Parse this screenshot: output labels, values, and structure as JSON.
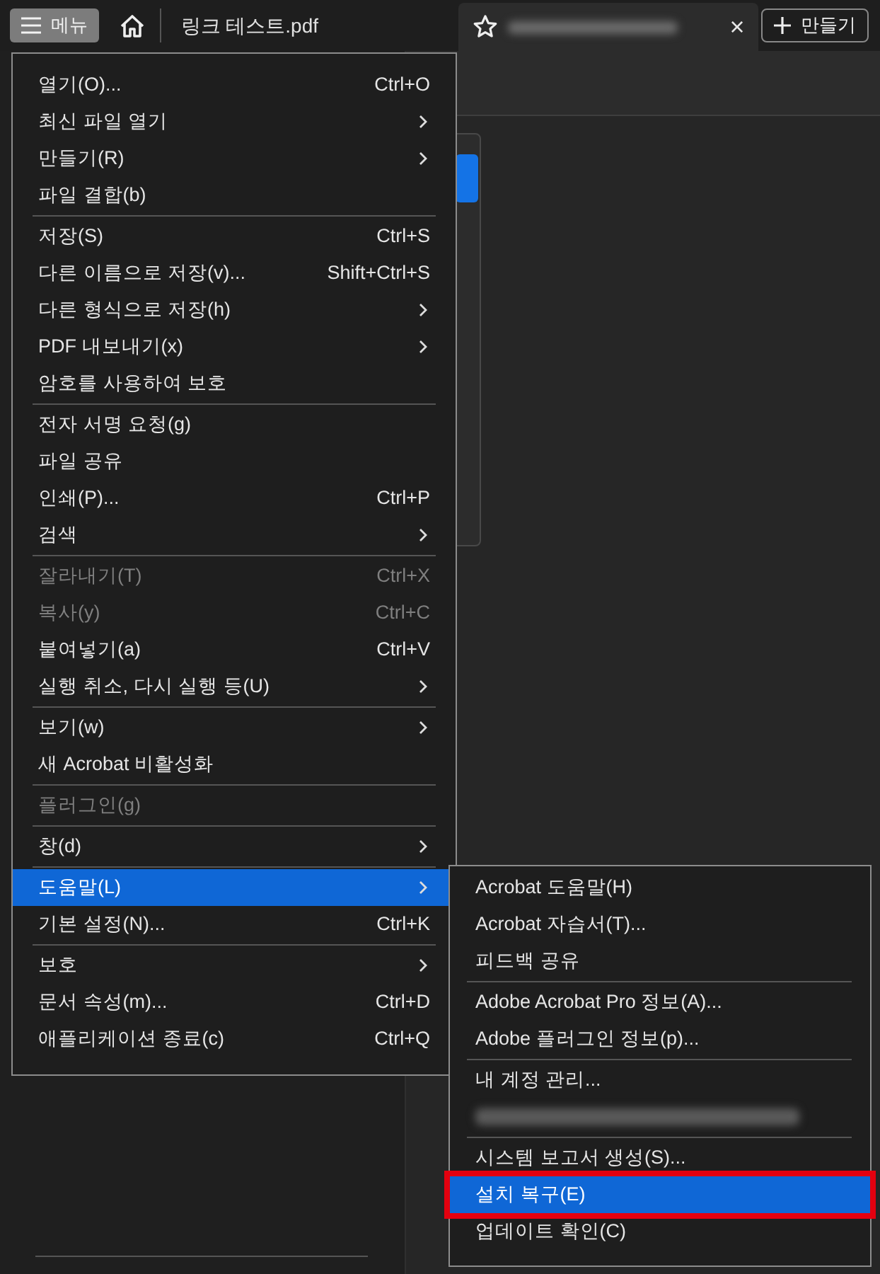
{
  "toolbar": {
    "menu_button": "메뉴",
    "document_tab": "링크 테스트.pdf",
    "second_tab": {
      "title_redacted": true,
      "close": "×"
    },
    "create_button": "만들기"
  },
  "menu": {
    "items": [
      {
        "kind": "item",
        "label": "열기(O)...",
        "shortcut": "Ctrl+O",
        "submenu": false,
        "disabled": false,
        "selected": false
      },
      {
        "kind": "item",
        "label": "최신 파일 열기",
        "submenu": true,
        "disabled": false,
        "selected": false
      },
      {
        "kind": "item",
        "label": "만들기(R)",
        "submenu": true,
        "disabled": false,
        "selected": false
      },
      {
        "kind": "item",
        "label": "파일 결합(b)",
        "submenu": false,
        "disabled": false,
        "selected": false
      },
      {
        "kind": "separator"
      },
      {
        "kind": "item",
        "label": "저장(S)",
        "shortcut": "Ctrl+S",
        "submenu": false,
        "disabled": false,
        "selected": false
      },
      {
        "kind": "item",
        "label": "다른 이름으로 저장(v)...",
        "shortcut": "Shift+Ctrl+S",
        "submenu": false,
        "disabled": false,
        "selected": false
      },
      {
        "kind": "item",
        "label": "다른 형식으로 저장(h)",
        "submenu": true,
        "disabled": false,
        "selected": false
      },
      {
        "kind": "item",
        "label": "PDF 내보내기(x)",
        "submenu": true,
        "disabled": false,
        "selected": false
      },
      {
        "kind": "item",
        "label": "암호를 사용하여 보호",
        "submenu": false,
        "disabled": false,
        "selected": false
      },
      {
        "kind": "separator"
      },
      {
        "kind": "item",
        "label": "전자 서명 요청(g)",
        "submenu": false,
        "disabled": false,
        "selected": false
      },
      {
        "kind": "item",
        "label": "파일 공유",
        "submenu": false,
        "disabled": false,
        "selected": false
      },
      {
        "kind": "item",
        "label": "인쇄(P)...",
        "shortcut": "Ctrl+P",
        "submenu": false,
        "disabled": false,
        "selected": false
      },
      {
        "kind": "item",
        "label": "검색",
        "submenu": true,
        "disabled": false,
        "selected": false
      },
      {
        "kind": "separator"
      },
      {
        "kind": "item",
        "label": "잘라내기(T)",
        "shortcut": "Ctrl+X",
        "submenu": false,
        "disabled": true,
        "selected": false
      },
      {
        "kind": "item",
        "label": "복사(y)",
        "shortcut": "Ctrl+C",
        "submenu": false,
        "disabled": true,
        "selected": false
      },
      {
        "kind": "item",
        "label": "붙여넣기(a)",
        "shortcut": "Ctrl+V",
        "submenu": false,
        "disabled": false,
        "selected": false
      },
      {
        "kind": "item",
        "label": "실행 취소, 다시 실행 등(U)",
        "submenu": true,
        "disabled": false,
        "selected": false
      },
      {
        "kind": "separator"
      },
      {
        "kind": "item",
        "label": "보기(w)",
        "submenu": true,
        "disabled": false,
        "selected": false
      },
      {
        "kind": "item",
        "label": "새 Acrobat 비활성화",
        "submenu": false,
        "disabled": false,
        "selected": false
      },
      {
        "kind": "separator"
      },
      {
        "kind": "item",
        "label": "플러그인(g)",
        "submenu": false,
        "disabled": true,
        "selected": false
      },
      {
        "kind": "separator"
      },
      {
        "kind": "item",
        "label": "창(d)",
        "submenu": true,
        "disabled": false,
        "selected": false
      },
      {
        "kind": "separator"
      },
      {
        "kind": "item",
        "label": "도움말(L)",
        "submenu": true,
        "disabled": false,
        "selected": true
      },
      {
        "kind": "item",
        "label": "기본 설정(N)...",
        "shortcut": "Ctrl+K",
        "submenu": false,
        "disabled": false,
        "selected": false
      },
      {
        "kind": "separator"
      },
      {
        "kind": "item",
        "label": "보호",
        "submenu": true,
        "disabled": false,
        "selected": false
      },
      {
        "kind": "item",
        "label": "문서 속성(m)...",
        "shortcut": "Ctrl+D",
        "submenu": false,
        "disabled": false,
        "selected": false
      },
      {
        "kind": "item",
        "label": "애플리케이션 종료(c)",
        "shortcut": "Ctrl+Q",
        "submenu": false,
        "disabled": false,
        "selected": false
      }
    ]
  },
  "submenu": {
    "items": [
      {
        "kind": "item",
        "label": "Acrobat 도움말(H)",
        "selected": false,
        "annotated": false
      },
      {
        "kind": "item",
        "label": "Acrobat 자습서(T)...",
        "selected": false,
        "annotated": false
      },
      {
        "kind": "item",
        "label": "피드백 공유",
        "selected": false,
        "annotated": false
      },
      {
        "kind": "separator"
      },
      {
        "kind": "item",
        "label": "Adobe Acrobat Pro 정보(A)...",
        "selected": false,
        "annotated": false
      },
      {
        "kind": "item",
        "label": "Adobe 플러그인 정보(p)...",
        "selected": false,
        "annotated": false
      },
      {
        "kind": "separator"
      },
      {
        "kind": "item",
        "label": "내 계정 관리...",
        "selected": false,
        "annotated": false
      },
      {
        "kind": "redacted"
      },
      {
        "kind": "separator"
      },
      {
        "kind": "item",
        "label": "시스템 보고서 생성(S)...",
        "selected": false,
        "annotated": false
      },
      {
        "kind": "item",
        "label": "설치 복구(E)",
        "selected": true,
        "annotated": true
      },
      {
        "kind": "item",
        "label": "업데이트 확인(C)",
        "selected": false,
        "annotated": false
      }
    ]
  }
}
